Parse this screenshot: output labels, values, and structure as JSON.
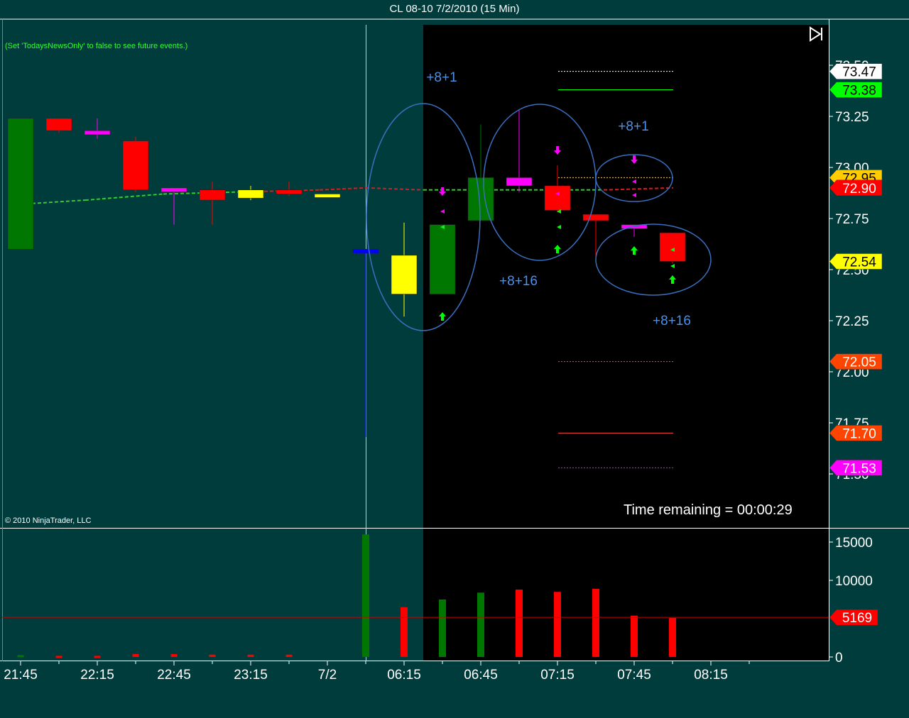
{
  "window": {
    "title": "CL 08-10  7/2/2010 (15 Min)",
    "news_note": "(Set 'TodaysNewsOnly' to false to see future events.)",
    "copyright": "© 2010 NinjaTrader, LLC",
    "time_remaining": "Time remaining = 00:00:29",
    "scroll_end_icon": "scroll-to-end-icon"
  },
  "colors": {
    "background": "#003c3c",
    "session_background": "#000000",
    "panel_border": "#ffffff",
    "up_bar": "#007700",
    "down_bar": "#ff0000",
    "ellipse": "#3a6fc0",
    "annotation_text": "#4d90e8",
    "ma_up": "#33cc33",
    "ma_down": "#cc2222",
    "volume_avg_line": "#cc0000"
  },
  "chart_data": [
    {
      "type": "candlestick",
      "panel": "price",
      "x_ticks": [
        "21:45",
        "22:15",
        "22:45",
        "23:15",
        "7/2",
        "06:15",
        "06:45",
        "07:15",
        "07:45",
        "08:15"
      ],
      "y_ticks": [
        71.5,
        71.75,
        72.0,
        72.25,
        72.5,
        72.75,
        73.0,
        73.25,
        73.5
      ],
      "ylim": [
        71.5,
        73.55
      ],
      "bars": [
        {
          "open": 72.6,
          "high": 73.24,
          "low": 73.14,
          "close": 73.24,
          "color": "#007700"
        },
        {
          "open": 73.24,
          "high": 73.24,
          "low": 73.17,
          "close": 73.18,
          "color": "#ff0000"
        },
        {
          "open": 73.18,
          "high": 73.24,
          "low": 73.14,
          "close": 73.16,
          "color": "#ff00ff"
        },
        {
          "open": 73.13,
          "high": 73.15,
          "low": 72.88,
          "close": 72.89,
          "color": "#ff0000"
        },
        {
          "open": 72.9,
          "high": 72.9,
          "low": 72.72,
          "close": 72.88,
          "color": "#ff00ff"
        },
        {
          "open": 72.89,
          "high": 72.93,
          "low": 72.72,
          "close": 72.84,
          "color": "#ff0000"
        },
        {
          "open": 72.89,
          "high": 72.91,
          "low": 72.84,
          "close": 72.85,
          "color": "#ffff00"
        },
        {
          "open": 72.89,
          "high": 72.93,
          "low": 72.86,
          "close": 72.87,
          "color": "#ff0000"
        },
        {
          "open": 72.87,
          "high": 72.87,
          "low": 72.86,
          "close": 72.86,
          "color": "#ffff00"
        },
        {
          "open": 72.6,
          "high": 72.6,
          "low": 71.68,
          "close": 72.58,
          "color": "#0000ff"
        },
        {
          "open": 72.57,
          "high": 72.73,
          "low": 72.27,
          "close": 72.38,
          "color": "#ffff00"
        },
        {
          "open": 72.38,
          "high": 72.72,
          "low": 72.38,
          "close": 72.72,
          "color": "#007700"
        },
        {
          "open": 72.74,
          "high": 73.21,
          "low": 72.74,
          "close": 72.95,
          "color": "#007700"
        },
        {
          "open": 72.95,
          "high": 73.28,
          "low": 72.88,
          "close": 72.91,
          "color": "#ff00ff"
        },
        {
          "open": 72.91,
          "high": 73.01,
          "low": 72.78,
          "close": 72.79,
          "color": "#ff0000"
        },
        {
          "open": 72.77,
          "high": 72.77,
          "low": 72.56,
          "close": 72.74,
          "color": "#ff0000"
        },
        {
          "open": 72.72,
          "high": 72.72,
          "low": 72.66,
          "close": 72.7,
          "color": "#ff00ff"
        },
        {
          "open": 72.68,
          "high": 72.68,
          "low": 72.53,
          "close": 72.54,
          "color": "#ff0000"
        }
      ],
      "price_markers": [
        {
          "label": "73.47",
          "value": 73.47,
          "color": "#ffffff",
          "text_color": "#000000"
        },
        {
          "label": "73.38",
          "value": 73.38,
          "color": "#00ff00",
          "text_color": "#000000"
        },
        {
          "label": "72.95",
          "value": 72.95,
          "color": "#ffcc00",
          "text_color": "#000000"
        },
        {
          "label": "72.90",
          "value": 72.9,
          "color": "#ff0000",
          "text_color": "#ffffff"
        },
        {
          "label": "72.54",
          "value": 72.54,
          "color": "#ffff00",
          "text_color": "#000000"
        },
        {
          "label": "72.05",
          "value": 72.05,
          "color": "#ff4400",
          "text_color": "#ffffff"
        },
        {
          "label": "71.70",
          "value": 71.7,
          "color": "#ff4400",
          "text_color": "#ffffff"
        },
        {
          "label": "71.53",
          "value": 71.53,
          "color": "#ff00ff",
          "text_color": "#ffffff"
        }
      ],
      "annotations": [
        "+8+1",
        "+8+16",
        "+8+1",
        "+8+16"
      ]
    },
    {
      "type": "bar",
      "panel": "volume",
      "y_ticks": [
        0,
        10000,
        15000
      ],
      "ylim": [
        0,
        16000
      ],
      "values": [
        250,
        150,
        150,
        400,
        380,
        300,
        300,
        300,
        0,
        16000,
        6500,
        7500,
        8400,
        8800,
        8500,
        8900,
        5400,
        5100
      ],
      "average_label": "5169",
      "average": 5169
    }
  ]
}
